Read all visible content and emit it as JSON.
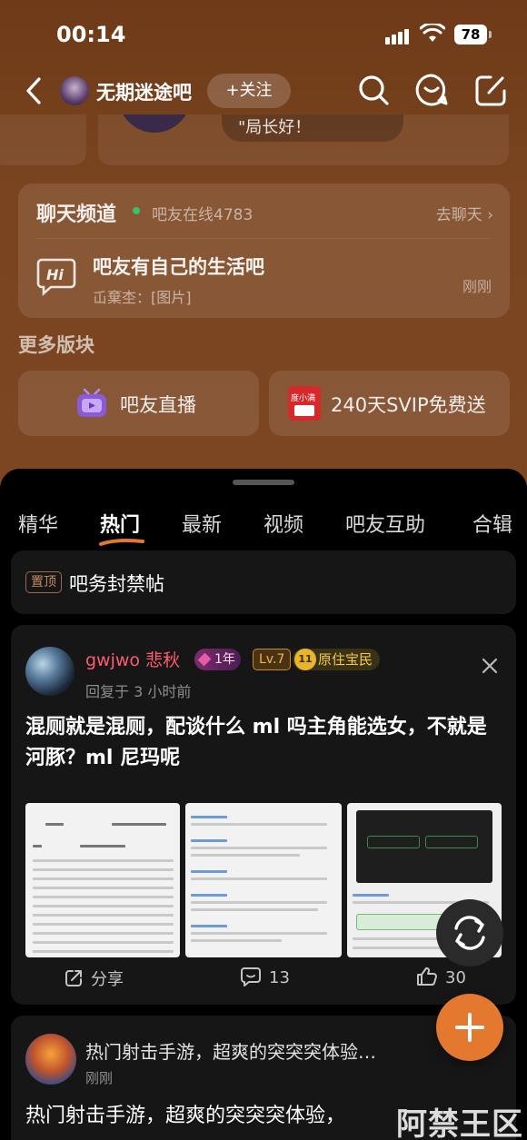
{
  "status": {
    "time": "00:14",
    "battery": "78"
  },
  "nav": {
    "forum_name": "无期迷途吧",
    "follow_label": "+关注"
  },
  "peek": {
    "bubble_text": "\"局长好！"
  },
  "chat": {
    "title": "聊天频道",
    "online": "吧友在线4783",
    "go_chat": "去聊天",
    "topic": "吧友有自己的生活吧",
    "last_message": "屲棄杢：[图片]",
    "time": "刚刚"
  },
  "more": {
    "title": "更多版块",
    "modules": [
      {
        "label": "吧友直播",
        "icon": "tv-icon"
      },
      {
        "label": "240天SVIP免费送",
        "icon": "du-xiaoman-icon"
      }
    ]
  },
  "tabs": [
    {
      "label": "精华",
      "active": false
    },
    {
      "label": "热门",
      "active": true
    },
    {
      "label": "最新",
      "active": false
    },
    {
      "label": "视频",
      "active": false
    },
    {
      "label": "吧友互助",
      "active": false
    },
    {
      "label": "合辑",
      "active": false
    }
  ],
  "pinned": {
    "badge": "置顶",
    "title": "吧务封禁帖"
  },
  "post": {
    "username": "gwjwo 悲秋",
    "badge_year": "1年",
    "badge_level": "Lv.7",
    "badge_resident_num": "11",
    "badge_resident": "原住宝民",
    "reply_time": "回复于 3 小时前",
    "title": "混厕就是混厕，配谈什么 ml 吗主角能选女，不就是河豚？ml 尼玛呢",
    "share_label": "分享",
    "comments": "13",
    "likes": "30"
  },
  "post2": {
    "title": "热门射击手游，超爽的突突突体验…",
    "time": "刚刚",
    "body": "热门射击手游，超爽的突突突体验，"
  },
  "watermark": "阿禁王区",
  "colors": {
    "accent": "#e3782e",
    "username": "#ff5a6e",
    "brown_bg": "#7a4420"
  }
}
